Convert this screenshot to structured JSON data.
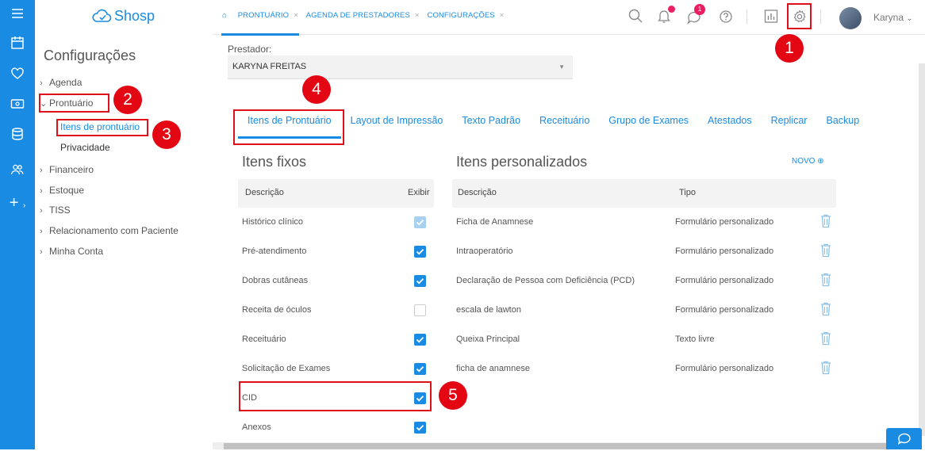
{
  "app": {
    "logo": "Shosp"
  },
  "rail_icons": [
    "menu-icon",
    "calendar-icon",
    "heart-icon",
    "money-icon",
    "database-icon",
    "users-icon",
    "plus-icon"
  ],
  "sidebar": {
    "title": "Configurações",
    "items": [
      {
        "label": "Agenda",
        "expanded": false
      },
      {
        "label": "Prontuário",
        "expanded": true,
        "children": [
          "Itens de prontuário",
          "Privacidade"
        ]
      },
      {
        "label": "Financeiro",
        "expanded": false
      },
      {
        "label": "Estoque",
        "expanded": false
      },
      {
        "label": "TISS",
        "expanded": false
      },
      {
        "label": "Relacionamento com Paciente",
        "expanded": false
      },
      {
        "label": "Minha Conta",
        "expanded": false
      }
    ]
  },
  "topnav": {
    "tabs": [
      "PRONTUÁRIO",
      "AGENDA DE PRESTADORES",
      "CONFIGURAÇÕES"
    ],
    "close_glyph": "×",
    "messages_badge": "1",
    "user": "Karyna"
  },
  "prestador": {
    "label": "Prestador:",
    "value": "KARYNA FREITAS"
  },
  "config_tabs": [
    "Itens de Prontuário",
    "Layout de Impressão",
    "Texto Padrão",
    "Receituário",
    "Grupo de Exames",
    "Atestados",
    "Replicar",
    "Backup"
  ],
  "fixed_items": {
    "title": "Itens fixos",
    "col_desc": "Descrição",
    "col_show": "Exibir",
    "rows": [
      {
        "desc": "Histórico clínico",
        "state": "disabled"
      },
      {
        "desc": "Pré-atendimento",
        "state": "checked"
      },
      {
        "desc": "Dobras cutâneas",
        "state": "checked"
      },
      {
        "desc": "Receita de óculos",
        "state": "unchecked"
      },
      {
        "desc": "Receituário",
        "state": "checked"
      },
      {
        "desc": "Solicitação de Exames",
        "state": "checked"
      },
      {
        "desc": "CID",
        "state": "checked"
      },
      {
        "desc": "Anexos",
        "state": "checked"
      }
    ]
  },
  "custom_items": {
    "title": "Itens personalizados",
    "new_label": "NOVO",
    "col_desc": "Descrição",
    "col_type": "Tipo",
    "rows": [
      {
        "desc": "Ficha de Anamnese",
        "type": "Formulário personalizado"
      },
      {
        "desc": "Intraoperatório",
        "type": "Formulário personalizado"
      },
      {
        "desc": "Declaração de Pessoa com Deficiência (PCD)",
        "type": "Formulário personalizado"
      },
      {
        "desc": "escala de lawton",
        "type": "Formulário personalizado"
      },
      {
        "desc": "Queixa Principal",
        "type": "Texto livre"
      },
      {
        "desc": "ficha de anamnese",
        "type": "Formulário personalizado"
      }
    ]
  },
  "markers": [
    "1",
    "2",
    "3",
    "4",
    "5"
  ],
  "colors": {
    "accent": "#1a8be3",
    "highlight": "#e0101a",
    "badge": "#e91e63"
  }
}
